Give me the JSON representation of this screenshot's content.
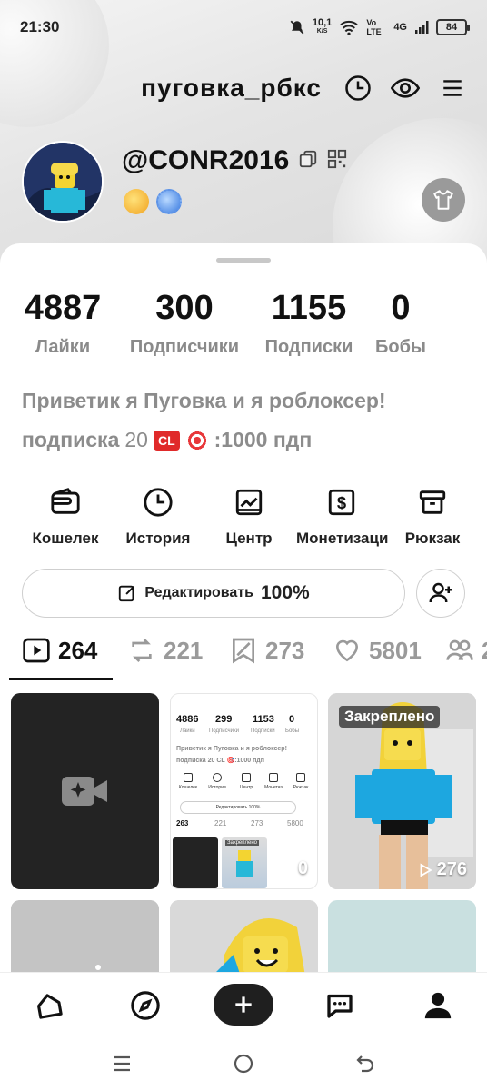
{
  "status_bar": {
    "time": "21:30",
    "net_speed": "10,1",
    "net_unit": "K/S",
    "volte": "Vo LTE",
    "network": "4G",
    "battery": "84"
  },
  "header": {
    "title": "пуговка_рбкс"
  },
  "profile": {
    "username": "@CONR2016"
  },
  "stats": [
    {
      "value": "4887",
      "label": "Лайки"
    },
    {
      "value": "300",
      "label": "Подписчики"
    },
    {
      "value": "1155",
      "label": "Подписки"
    },
    {
      "value": "0",
      "label": "Бобы"
    }
  ],
  "bio": {
    "line1": "Приветик я Пуговка и я роблоксер!",
    "line2_prefix": "подписка",
    "line2_num": "20",
    "cl_badge": "CL",
    "line2_suffix": ":1000 пдп"
  },
  "tools": [
    {
      "label": "Кошелек",
      "icon": "wallet-icon"
    },
    {
      "label": "История",
      "icon": "clock-icon"
    },
    {
      "label": "Центр",
      "icon": "chart-icon"
    },
    {
      "label": "Монетизаци",
      "icon": "dollar-icon"
    },
    {
      "label": "Рюкзак",
      "icon": "backpack-icon"
    }
  ],
  "edit": {
    "label": "Редактировать",
    "percent": "100%"
  },
  "tabs": [
    {
      "count": "264",
      "icon": "play-icon"
    },
    {
      "count": "221",
      "icon": "repost-icon"
    },
    {
      "count": "273",
      "icon": "bookmark-icon"
    },
    {
      "count": "5801",
      "icon": "heart-icon"
    },
    {
      "count": "2",
      "icon": "friends-icon"
    }
  ],
  "grid": {
    "pinned_label": "Закреплено",
    "snapshot_views": "0",
    "pinned_views": "276",
    "snapshot": {
      "stats": [
        {
          "value": "4886",
          "label": "Лайки"
        },
        {
          "value": "299",
          "label": "Подписчики"
        },
        {
          "value": "1153",
          "label": "Подписки"
        },
        {
          "value": "0",
          "label": "Бобы"
        }
      ],
      "bio1": "Приветик я Пуговка и я роблоксер!",
      "bio2": "подписка 20 CL 🎯:1000 пдп",
      "tools": [
        "Кошелек",
        "История",
        "Центр",
        "Монетиз",
        "Рюкзак"
      ],
      "edit": "Редактировать 100%",
      "tabs": [
        "263",
        "221",
        "273",
        "5800"
      ],
      "pinned": "Закреплено"
    }
  }
}
